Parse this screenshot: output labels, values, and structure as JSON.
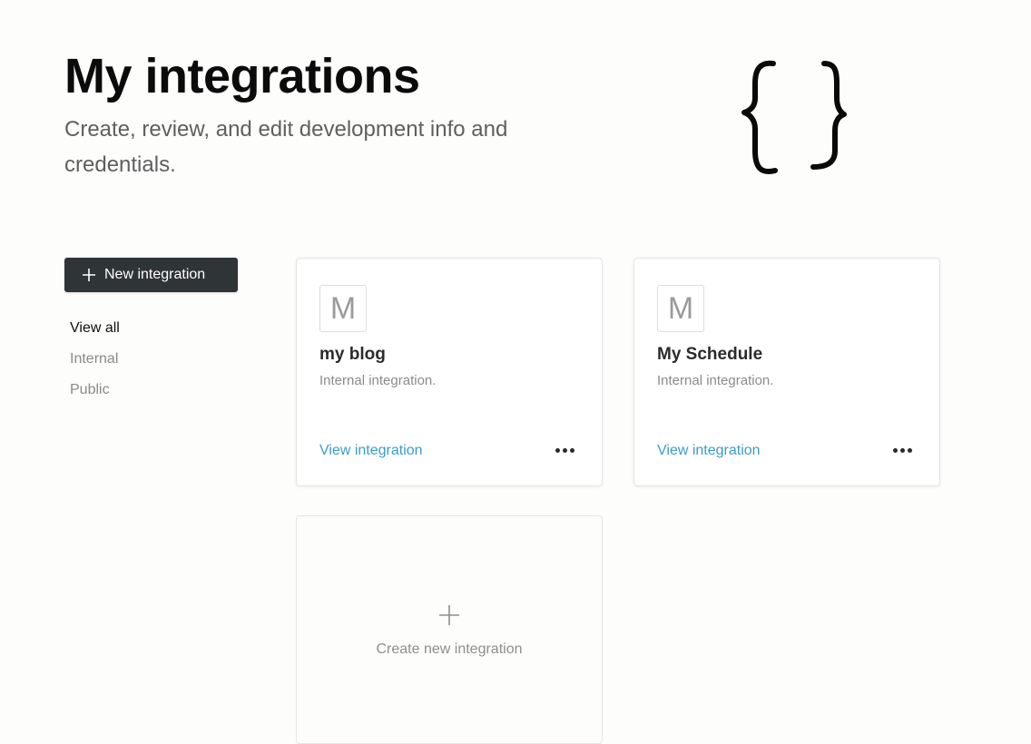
{
  "header": {
    "title": "My integrations",
    "subtitle": "Create, review, and edit development info and credentials."
  },
  "sidebar": {
    "new_button_label": "New integration",
    "filters": [
      {
        "label": "View all",
        "active": true
      },
      {
        "label": "Internal",
        "active": false
      },
      {
        "label": "Public",
        "active": false
      }
    ]
  },
  "integrations": [
    {
      "avatar_letter": "M",
      "name": "my blog",
      "type": "Internal integration.",
      "link_label": "View integration"
    },
    {
      "avatar_letter": "M",
      "name": "My Schedule",
      "type": "Internal integration.",
      "link_label": "View integration"
    }
  ],
  "create_card": {
    "label": "Create new integration"
  },
  "icons": {
    "hero": "curly-braces-icon",
    "new_button": "plus-icon",
    "card_menu": "more-horizontal-icon",
    "create": "plus-icon"
  },
  "colors": {
    "background": "#fdfdfc",
    "button_bg": "#2f3437",
    "link": "#3b9bd1",
    "muted_text": "#8a8a8a"
  }
}
